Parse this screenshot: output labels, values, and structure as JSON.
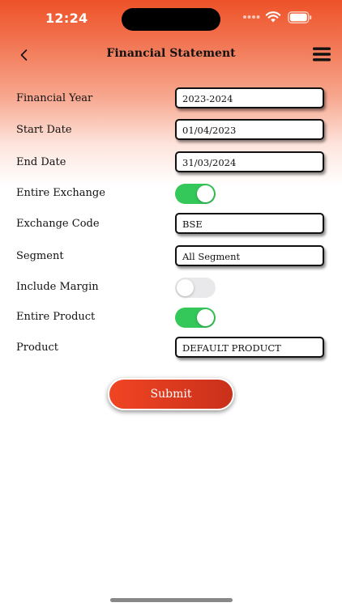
{
  "status_bar": {
    "time": "12:24"
  },
  "header": {
    "title": "Financial Statement"
  },
  "form": {
    "financial_year": {
      "label": "Financial Year",
      "value": "2023-2024"
    },
    "start_date": {
      "label": "Start Date",
      "value": "01/04/2023"
    },
    "end_date": {
      "label": "End Date",
      "value": "31/03/2024"
    },
    "entire_exchange": {
      "label": "Entire Exchange",
      "on": true
    },
    "exchange_code": {
      "label": "Exchange Code",
      "value": "BSE"
    },
    "segment": {
      "label": "Segment",
      "value": "All Segment"
    },
    "include_margin": {
      "label": "Include Margin",
      "on": false
    },
    "entire_product": {
      "label": "Entire Product",
      "on": true
    },
    "product": {
      "label": "Product",
      "value": "DEFAULT PRODUCT"
    }
  },
  "submit_label": "Submit",
  "colors": {
    "accent": "#ee5228",
    "toggle_on": "#34c759",
    "toggle_off": "#e9e9eb"
  }
}
